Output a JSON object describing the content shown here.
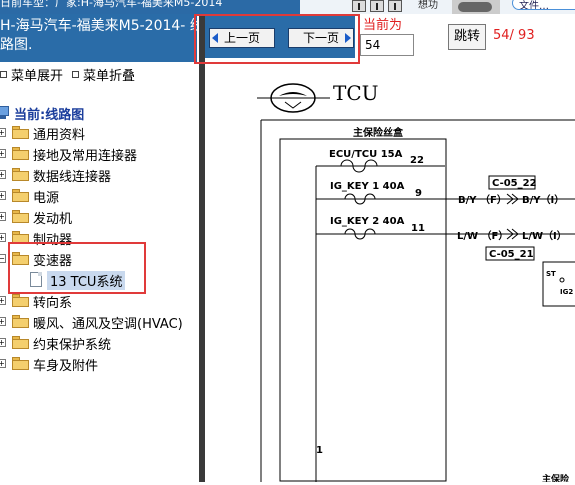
{
  "top_strip": {
    "crumb": "日前车型：厂家:H-海马汽车-福美来M5-2014",
    "right_text": "想功",
    "pill_text": "文件…"
  },
  "left_panel": {
    "header_line1": "H-海马汽车-福美来M5-2014- 线",
    "header_line2": "路图.",
    "expand_label": "菜单展开",
    "collapse_label": "菜单折叠",
    "root_label": "当前:线路图",
    "tree": [
      {
        "label": "通用资料",
        "state": "collapsed"
      },
      {
        "label": "接地及常用连接器",
        "state": "collapsed"
      },
      {
        "label": "数据线连接器",
        "state": "collapsed"
      },
      {
        "label": "电源",
        "state": "collapsed"
      },
      {
        "label": "发动机",
        "state": "collapsed"
      },
      {
        "label": "制动器",
        "state": "collapsed"
      },
      {
        "label": "变速器",
        "state": "expanded"
      },
      {
        "label": "13 TCU系统",
        "state": "leaf-selected"
      },
      {
        "label": "转向系",
        "state": "collapsed"
      },
      {
        "label": "暖风、通风及空调(HVAC)",
        "state": "collapsed"
      },
      {
        "label": "约束保护系统",
        "state": "collapsed"
      },
      {
        "label": "车身及附件",
        "state": "collapsed"
      }
    ]
  },
  "navbar": {
    "prev_label": "上一页",
    "next_label": "下一页",
    "current_label": "当前为",
    "page_value": "54",
    "jump_label": "跳转",
    "page_count": "54/ 93"
  },
  "diagram": {
    "logo_text": "TCU",
    "box_title": "主保险丝盒",
    "fuses": [
      {
        "name": "ECU/TCU 15A",
        "pin": "22"
      },
      {
        "name": "IG_KEY 1 40A",
        "pin": "9"
      },
      {
        "name": "IG_KEY 2 40A",
        "pin": "11"
      }
    ],
    "connector_top": "C-05_22",
    "connector_bottom": "C-05_21",
    "wire1_left": "B/Y （F）",
    "wire1_right": "B/Y（I）",
    "wire2_left": "L/W （F）",
    "wire2_right": "L/W（I）",
    "relay_st": "ST",
    "relay_ig2": "IG2",
    "pin_bottom": "1",
    "bottom_label": "主保险"
  },
  "colors": {
    "header_blue": "#2a6ca8",
    "highlight_red": "#e03a3a",
    "page_red": "#e02020",
    "selected_bg": "#c9d9ee"
  }
}
